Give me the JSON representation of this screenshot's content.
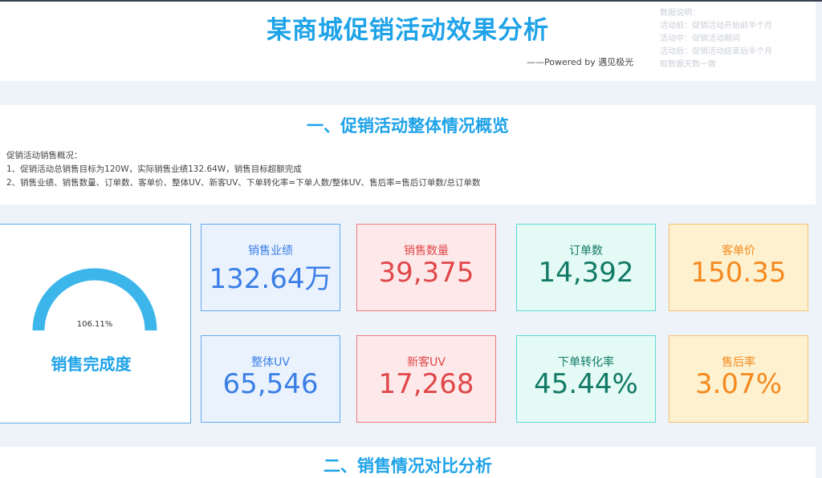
{
  "header": {
    "title": "某商城促销活动效果分析",
    "powered": "——Powered by 遇见极光",
    "notes": [
      "数据说明：",
      "活动前：促销活动开始前半个月",
      "活动中：促销活动期间",
      "活动后：促销活动结束后半个月",
      "取数据天数一致"
    ]
  },
  "section1": {
    "title": "一、促销活动整体情况概览",
    "overview": [
      "促销活动销售概况：",
      "1、促销活动总销售目标为120W，实际销售业绩132.64W，销售目标超额完成",
      "2、销售业绩、销售数量、订单数、客单价、整体UV、新客UV、下单转化率=下单人数/整体UV、售后率=售后订单数/总订单数"
    ]
  },
  "gauge": {
    "value_text": "106.11%",
    "value": 1.0611,
    "label": "销售完成度",
    "color": "#3cb6ea"
  },
  "metrics": [
    {
      "label": "销售业绩",
      "value": "132.64万",
      "theme": "blue"
    },
    {
      "label": "销售数量",
      "value": "39,375",
      "theme": "red"
    },
    {
      "label": "订单数",
      "value": "14,392",
      "theme": "teal"
    },
    {
      "label": "客单价",
      "value": "150.35",
      "theme": "orange"
    },
    {
      "label": "整体UV",
      "value": "65,546",
      "theme": "blue"
    },
    {
      "label": "新客UV",
      "value": "17,268",
      "theme": "red"
    },
    {
      "label": "下单转化率",
      "value": "45.44%",
      "theme": "teal"
    },
    {
      "label": "售后率",
      "value": "3.07%",
      "theme": "orange"
    }
  ],
  "section2": {
    "title": "二、销售情况对比分析"
  }
}
